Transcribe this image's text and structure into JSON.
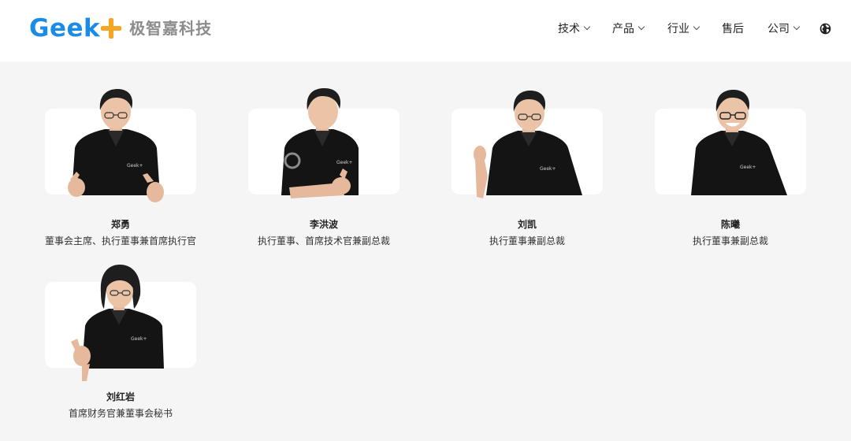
{
  "brand": {
    "word": "Geek",
    "chinese": "极智嘉科技"
  },
  "nav": [
    {
      "label": "技术",
      "dropdown": true
    },
    {
      "label": "产品",
      "dropdown": true
    },
    {
      "label": "行业",
      "dropdown": true
    },
    {
      "label": "售后",
      "dropdown": false
    },
    {
      "label": "公司",
      "dropdown": true
    }
  ],
  "language_icon": "globe-icon",
  "colors": {
    "brand_blue": "#1a8ce8",
    "brand_orange": "#f5a623",
    "page_bg": "#f5f5f5",
    "card_bg": "#ffffff",
    "shirt": "#141414"
  },
  "team": [
    {
      "name": "郑勇",
      "title": "董事会主席、执行董事兼首席执行官"
    },
    {
      "name": "李洪波",
      "title": "执行董事、首席技术官兼副总裁"
    },
    {
      "name": "刘凯",
      "title": "执行董事兼副总裁"
    },
    {
      "name": "陈曦",
      "title": "执行董事兼副总裁"
    },
    {
      "name": "刘红岩",
      "title": "首席财务官兼董事会秘书"
    }
  ],
  "shirt_logo": "Geek+"
}
